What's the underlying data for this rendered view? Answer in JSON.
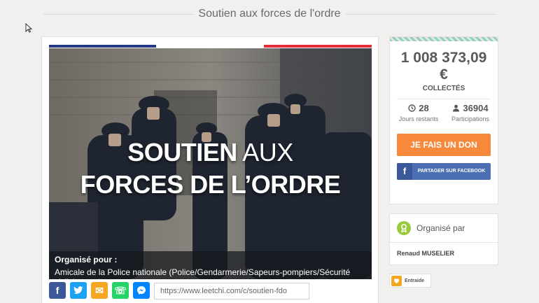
{
  "header": {
    "title": "Soutien aux forces de l'ordre"
  },
  "hero": {
    "headline_bold_1": "SOUTIEN",
    "headline_thin_1": " AUX",
    "headline_2": "FORCES DE L’ORDRE",
    "organized_for_label": "Organisé pour :",
    "organized_for": "Amicale de la Police nationale (Police/Gendarmerie/Sapeurs-pompiers/Sécurité civile)"
  },
  "share": {
    "url": "https://www.leetchi.com/c/soutien-fdo",
    "facebook_glyph": "f",
    "twitter_glyph": "t",
    "email_glyph": "✉",
    "whatsapp_glyph": "☏",
    "messenger_glyph": "✉"
  },
  "stats": {
    "amount": "1 008 373,09",
    "currency": "€",
    "collected_label": "COLLECTÉS",
    "days_value": "28",
    "days_label": "Jours restants",
    "participants_value": "36904",
    "participants_label": "Participations",
    "donate_label": "JE FAIS UN DON",
    "facebook_label": "PARTAGER SUR FACEBOOK",
    "facebook_glyph": "f"
  },
  "organizer": {
    "header": "Organisé par",
    "name": "Renaud MUSELIER"
  },
  "badge": {
    "label": "Entraide"
  },
  "colors": {
    "background": "#f1f0ee",
    "donate": "#f7893d",
    "facebook": "#4c6fb3",
    "flag_blue": "#243a86",
    "flag_red": "#e52c3b",
    "accent_green": "#9ac93e"
  }
}
